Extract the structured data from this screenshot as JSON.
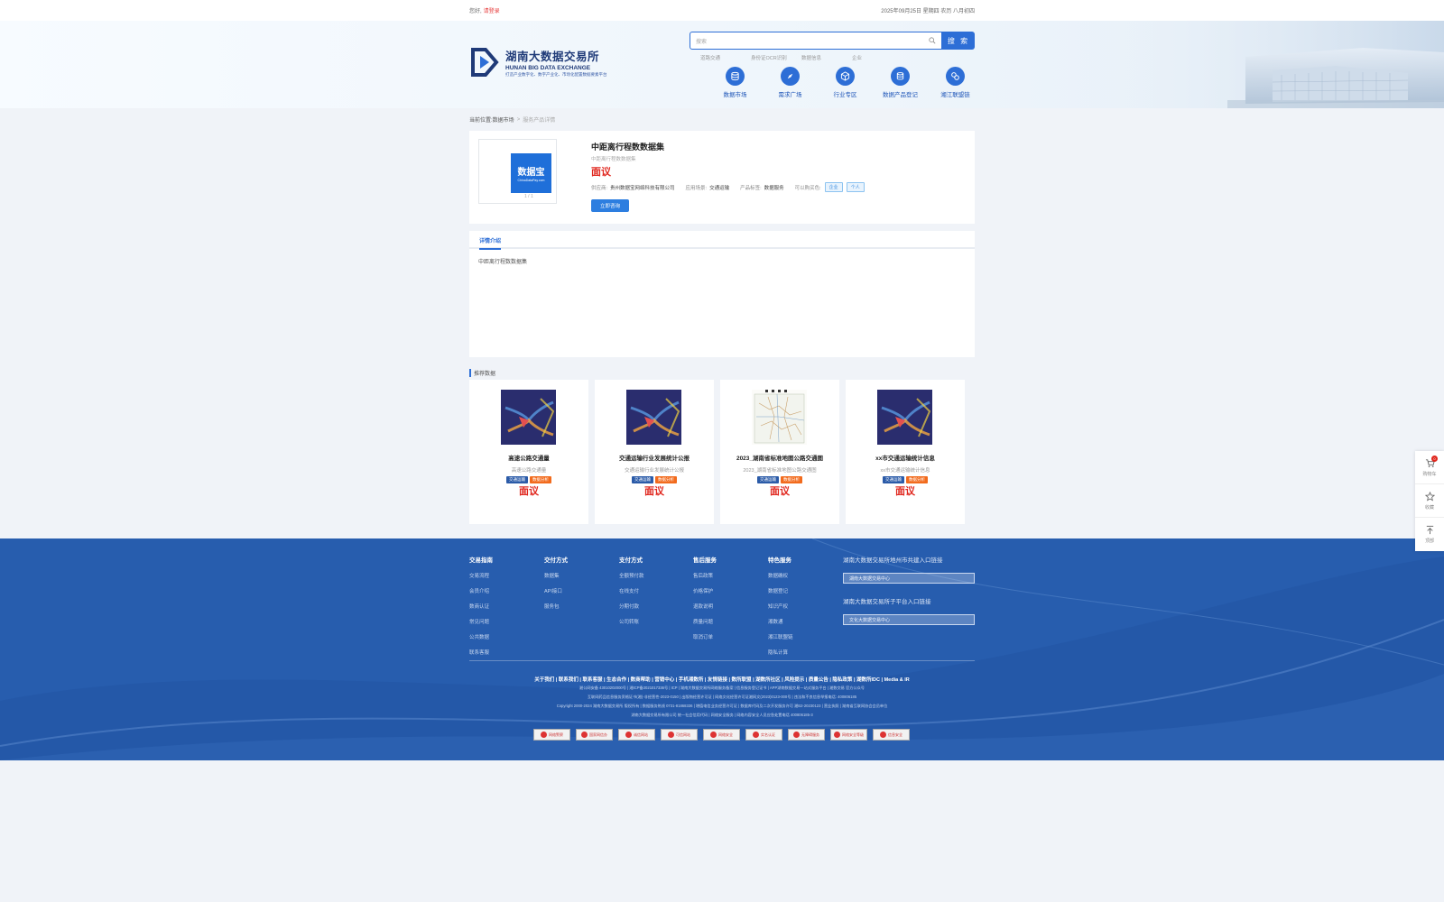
{
  "topbar": {
    "greeting": "您好,",
    "login": "请登录",
    "date_text": "2025年09月25日 星期四 农历 八月初四"
  },
  "header": {
    "logo_cn": "湖南大数据交易所",
    "logo_en": "HUNAN BIG DATA EXCHANGE",
    "logo_slogan": "打造产业数字化、数字产业化、市场化配置数据要素平台",
    "search_placeholder": "搜索",
    "search_button": "搜 索",
    "hotwords": [
      "道路交通",
      "身份证OCR识别",
      "数据信息",
      "企业"
    ],
    "nav": [
      {
        "label": "数据市场",
        "icon": "database-icon"
      },
      {
        "label": "需求广场",
        "icon": "compass-icon"
      },
      {
        "label": "行业专区",
        "icon": "cube-icon"
      },
      {
        "label": "数据产品登记",
        "icon": "register-icon"
      },
      {
        "label": "湘江联盟链",
        "icon": "chain-link-icon"
      }
    ]
  },
  "breadcrumb": {
    "prefix": "当前位置:",
    "level1": "数据市场",
    "sep": ">",
    "current": "服务产品详情"
  },
  "product": {
    "thumb_text": "数据宝",
    "thumb_subtext": "ChinaDataPay.com",
    "thumb_pager": "1 / 1",
    "title": "中距离行程数数据集",
    "subtitle": "中距离行程数数据集",
    "price": "面议",
    "supplier_label": "供应商:",
    "supplier": "贵州数据宝网络科技有限公司",
    "scene_label": "应用场景:",
    "scene": "交通运输",
    "type_label": "产品标签:",
    "type": "数据服务",
    "buyer_label": "可以购买色:",
    "buyer_tags": [
      "企业",
      "个人"
    ],
    "consult_button": "立即咨询"
  },
  "detail": {
    "tab": "详情介绍",
    "content": "中距离行程数数据集"
  },
  "recommend": {
    "title": "推荐数据",
    "items": [
      {
        "name": "高速公路交通量",
        "sub": "高速公路交通量",
        "tags": [
          "交通运输",
          "数据分析"
        ],
        "price": "面议"
      },
      {
        "name": "交通运输行业发展统计公报",
        "sub": "交通运输行业发展统计公报",
        "tags": [
          "交通运输",
          "数据分析"
        ],
        "price": "面议"
      },
      {
        "name": "2023_湖南省标准地图公路交通图",
        "sub": "2023_湖南省标准地图公路交通图",
        "tags": [
          "交通运输",
          "数据分析"
        ],
        "price": "面议"
      },
      {
        "name": "xx市交通运输统计信息",
        "sub": "xx市交通运输统计信息",
        "tags": [
          "交通运输",
          "数据分析"
        ],
        "price": "面议"
      }
    ]
  },
  "footer": {
    "columns": [
      {
        "title": "交易指南",
        "items": [
          "交易流程",
          "会员介绍",
          "数商认证",
          "常见问题",
          "公共数据",
          "联系客服"
        ]
      },
      {
        "title": "交付方式",
        "items": [
          "数据集",
          "API接口",
          "服务包"
        ]
      },
      {
        "title": "支付方式",
        "items": [
          "全额预付款",
          "在线支付",
          "分期付款",
          "公司转账"
        ]
      },
      {
        "title": "售后服务",
        "items": [
          "售后政策",
          "价格保护",
          "退款说明",
          "质量问题",
          "取消订单"
        ]
      },
      {
        "title": "特色服务",
        "items": [
          "数据确权",
          "数据登记",
          "知识产权",
          "湘数通",
          "湘江联盟链",
          "隐私计算"
        ]
      }
    ],
    "right_title1": "湖南大数据交易所地州市共建入口链接",
    "right_select1": "湖南大数据交易中心",
    "right_title2": "湖南大数据交易所子平台入口链接",
    "right_select2": "文化大数据交易中心",
    "links": "关于我们 | 联系我们 | 联系客服 | 生态合作 | 数商帮助 | 营销中心 | 手机湘数所 | 友情链接 | 数所联盟 | 湖数所社区 | 风险提示 | 质量公告 | 隐私政策 | 湖数所IDC | Media & IR",
    "line1": "湘公网安备 43010202000号 | 湘ICP备2021017336号 | ICP | 湖南大数据交易所网络服务备案 | 信息服务登记证书 | APP湖南数据交易一站式服务平台 | 湘数交易 官方公众号",
    "line2": "互联网药品信息服务资格证书(湘)-非经营性-2023-0150 | 出版物经营许可证 | 网络文化经营许可证湘网文(2023)0123-000号 | 违法和不良信息举报电话: 400806185",
    "line3": "Copyright 2000-2024 湖南大数据交易所 版权所有 | 数据服务热线 0731-81868336 | 增值电信业务经营许可证 | 数据库代码及二次开发服务许可 湘B2-20230123 | 营业执照 | 湖南省互联网协会会员单位",
    "line4": "湖南大数据交易所有限公司 统一社会信用代码 | 网络安全服务 | 网络内容安全人员应急处置电话 400806185-3",
    "badges": [
      "网络警察",
      "国家网信办",
      "诚信网站",
      "可信网站",
      "网络安全",
      "实名认证",
      "无障碍服务",
      "网络安全等级",
      "信息安全"
    ]
  },
  "sidebar": {
    "cart_label": "购物车",
    "cart_count": "0",
    "fav_label": "收藏",
    "top_label": "顶部"
  }
}
